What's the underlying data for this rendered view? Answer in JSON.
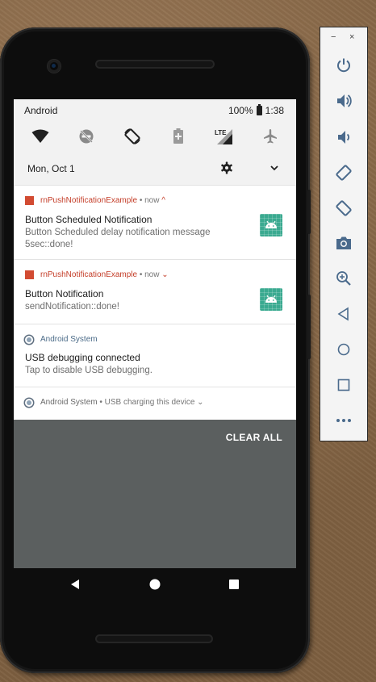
{
  "status_bar": {
    "carrier": "Android",
    "battery": "100%",
    "time": "1:38"
  },
  "quick_settings": {
    "icons": [
      "wifi-icon",
      "do-not-disturb-off-icon",
      "auto-rotate-icon",
      "battery-saver-icon",
      "lte-signal-icon",
      "airplane-mode-icon"
    ]
  },
  "header": {
    "date": "Mon, Oct 1"
  },
  "notifications": [
    {
      "app": "rnPushNotificationExample",
      "meta": " • now ",
      "chevron": "^",
      "title": "Button Scheduled Notification",
      "text": "Button Scheduled delay notification message 5sec::done!"
    },
    {
      "app": "rnPushNotificationExample",
      "meta": " • now ",
      "chevron": "⌄",
      "title": "Button Notification",
      "text": "sendNotification::done!"
    },
    {
      "app": "Android System",
      "title": "USB debugging connected",
      "text": "Tap to disable USB debugging."
    },
    {
      "app": "Android System",
      "summary": " • USB charging this device ",
      "chevron": "⌄"
    }
  ],
  "clear_all": "CLEAR ALL",
  "emulator_panel": {
    "minimize": "−",
    "close": "×",
    "buttons": [
      "power-icon",
      "volume-up-icon",
      "volume-down-icon",
      "rotate-left-icon",
      "rotate-right-icon",
      "camera-icon",
      "zoom-icon",
      "back-icon",
      "home-icon",
      "overview-icon",
      "more-icon"
    ]
  },
  "colors": {
    "app_accent": "#c43d28",
    "system_accent": "#4b6b88",
    "thumb": "#3aaa90",
    "scrim": "#5b5f5f"
  }
}
